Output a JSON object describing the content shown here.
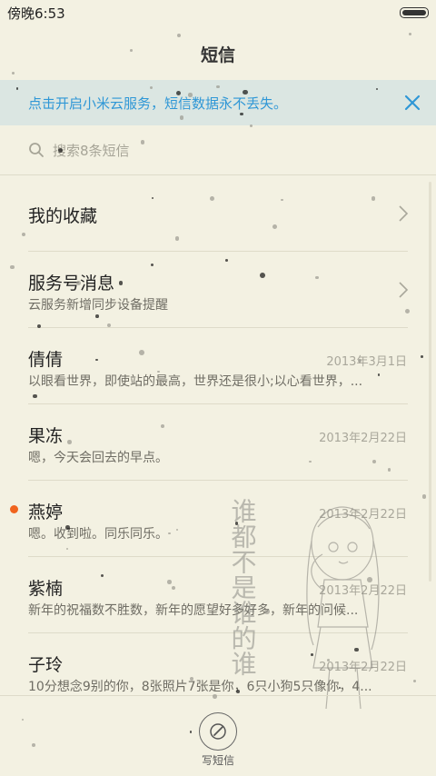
{
  "status_bar": {
    "time": "傍晚6:53"
  },
  "header": {
    "title": "短信"
  },
  "cloud_banner": {
    "text": "点击开启小米云服务，短信数据永不丢失。"
  },
  "search": {
    "placeholder": "搜索8条短信"
  },
  "rows": [
    {
      "title": "我的收藏",
      "subtitle": "",
      "date": ""
    },
    {
      "title": "服务号消息",
      "subtitle": "云服务新增同步设备提醒",
      "date": ""
    },
    {
      "title": "倩倩",
      "subtitle": "以眼看世界，即使站的最高，世界还是很小;以心看世界，...",
      "date": "2013年3月1日"
    },
    {
      "title": "果冻",
      "subtitle": "嗯，今天会回去的早点。",
      "date": "2013年2月22日"
    },
    {
      "title": "燕婷",
      "subtitle": "嗯。收到啦。同乐同乐。",
      "date": "2013年2月22日",
      "unread": true
    },
    {
      "title": "紫楠",
      "subtitle": "新年的祝福数不胜数，新年的愿望好多好多，新年的问候...",
      "date": "2013年2月22日"
    },
    {
      "title": "子玲",
      "subtitle": "10分想念9别的你，8张照片7张是你，6只小狗5只像你，4...",
      "date": "2013年2月22日"
    }
  ],
  "bottom": {
    "compose_label": "写短信"
  },
  "watermark_text": "谁都不是谁的谁",
  "colors": {
    "accent": "#2f97d6",
    "unread": "#f0641e",
    "background": "#f3f1e2",
    "banner": "#dbe6e2"
  },
  "icons": [
    "battery-icon",
    "close-icon",
    "search-icon",
    "chevron-right-icon",
    "compose-icon"
  ]
}
